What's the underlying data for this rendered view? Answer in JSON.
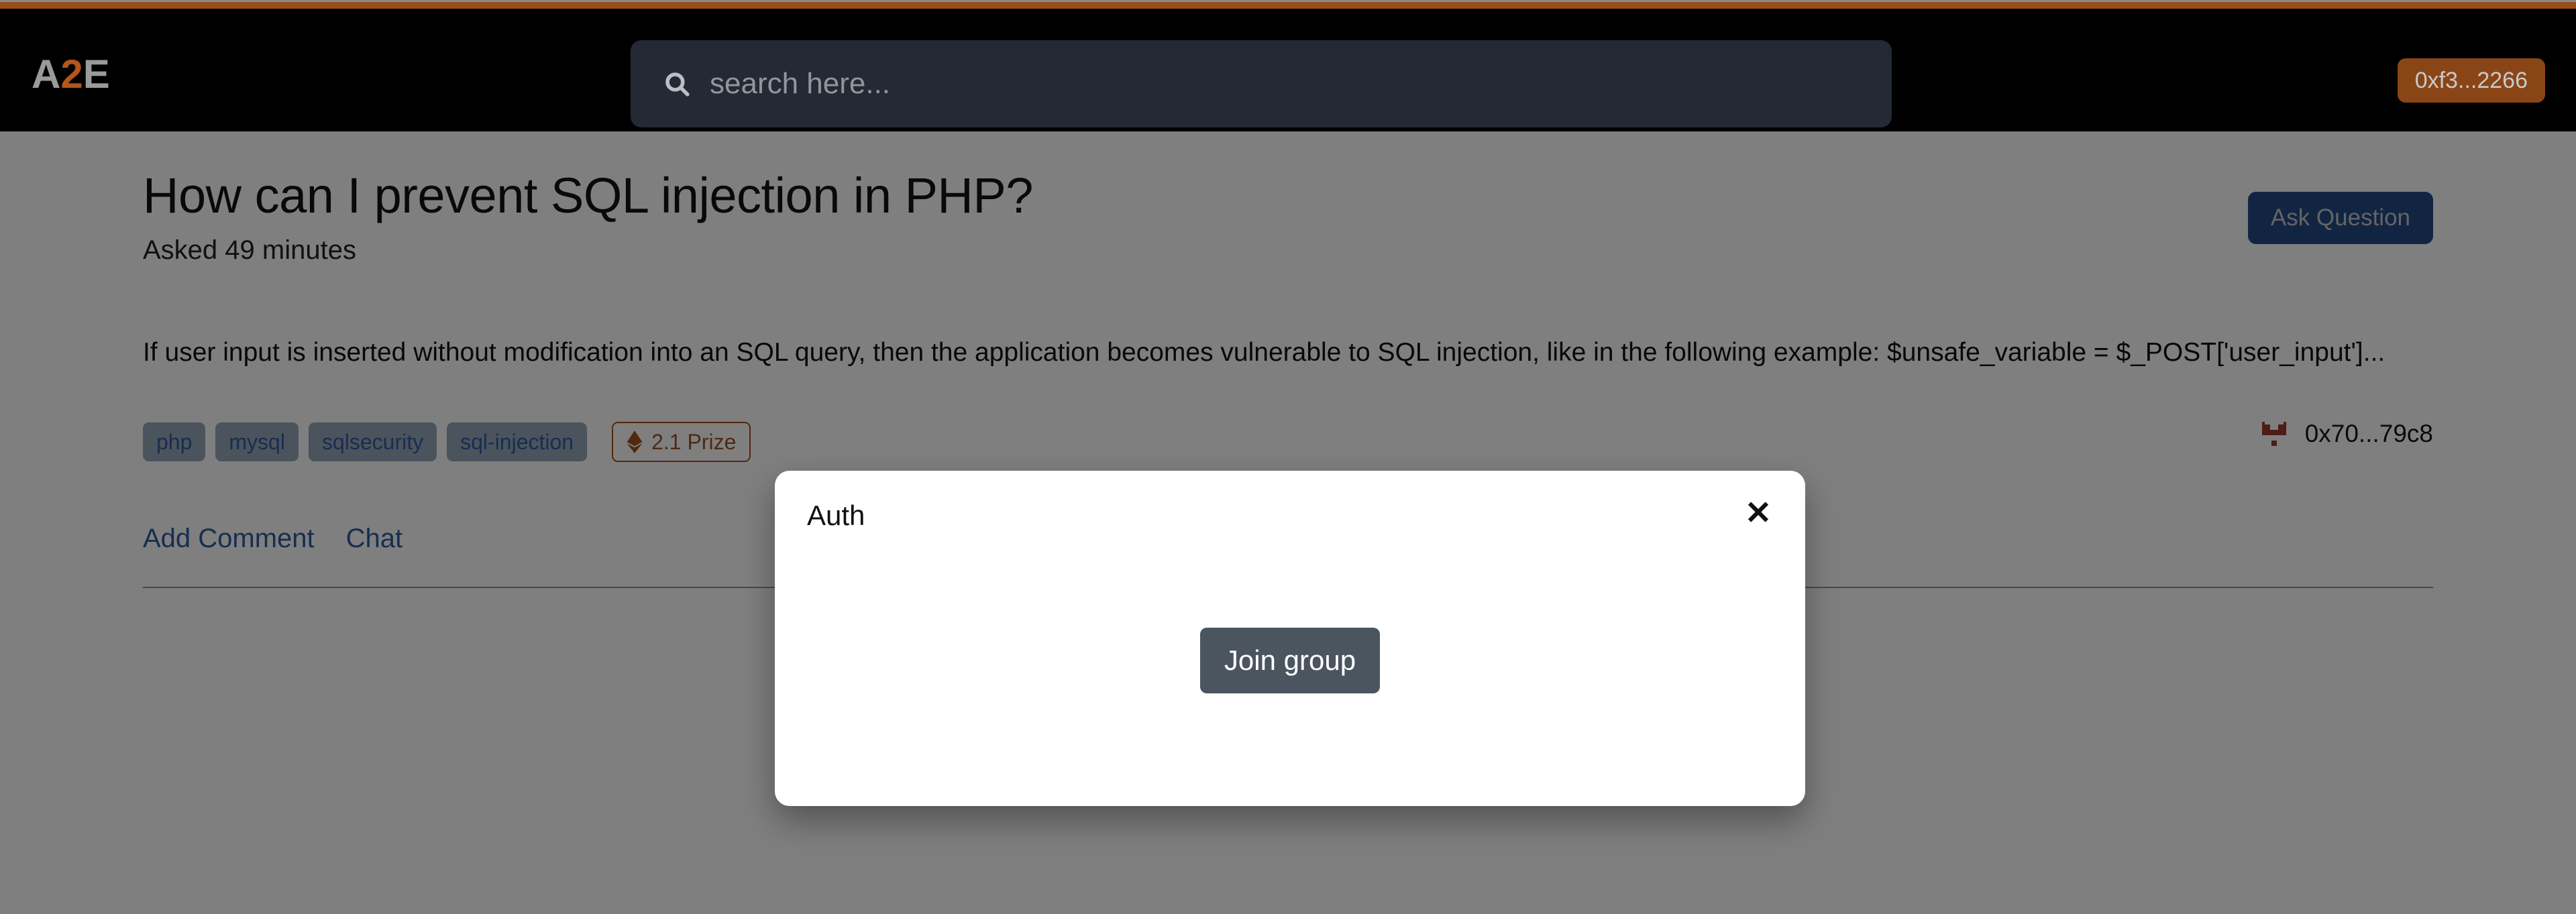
{
  "theme": {
    "accent_orange": "#9a4e17",
    "header_bg": "#000000",
    "search_bg": "#242a33",
    "wallet_bg": "#8a4517",
    "ask_button_bg": "#234a87",
    "tag_bg": "#97a7ba",
    "tag_text": "#2e5c9e",
    "prize_color": "#a0521d",
    "join_button_bg": "#4b555f",
    "overlay": "rgba(0,0,0,0.5)"
  },
  "header": {
    "logo": {
      "part1": "A",
      "part2": "2",
      "part3": "E"
    },
    "search": {
      "placeholder": "search here...",
      "value": "",
      "icon": "search-icon"
    },
    "wallet": {
      "label": "0xf3...2266"
    }
  },
  "question": {
    "title": "How can I prevent SQL injection in PHP?",
    "asked": "Asked 49 minutes",
    "body": "If user input is inserted without modification into an SQL query, then the application becomes vulnerable to SQL injection, like in the following example: $unsafe_variable = $_POST['user_input']...",
    "ask_button": "Ask Question",
    "tags": [
      "php",
      "mysql",
      "sqlsecurity",
      "sql-injection"
    ],
    "prize": {
      "icon": "ethereum-icon",
      "label": "2.1 Prize"
    },
    "owner": {
      "icon": "identicon-avatar",
      "address": "0x70...79c8"
    },
    "actions": [
      {
        "label": "Add Comment"
      },
      {
        "label": "Chat"
      }
    ]
  },
  "modal": {
    "title": "Auth",
    "close_label": "✕",
    "join_button": "Join group"
  }
}
